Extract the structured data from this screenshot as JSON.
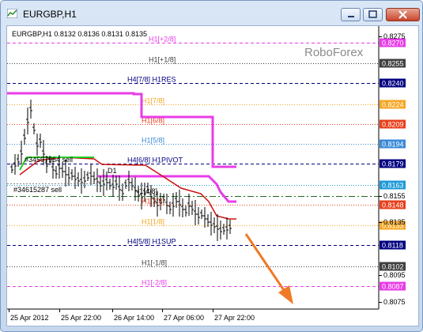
{
  "window": {
    "title": "EURGBP,H1"
  },
  "chart": {
    "symbol_line": "EURGBP,H1  0.8132 0.8136 0.8131 0.8135",
    "brand": "RoboForex",
    "annotations": [
      "#34597964 sell",
      "#34615287 sell",
      "D1",
      "H1[4/8]"
    ]
  },
  "price_axis": {
    "labels": [
      "0.8275",
      "0.8270",
      "0.8255",
      "0.8240",
      "0.8224",
      "0.8209",
      "0.8194",
      "0.8179",
      "0.8163",
      "0.8155",
      "0.8148",
      "0.8135",
      "0.8133",
      "0.8118",
      "0.8102",
      "0.8095",
      "0.8087",
      "0.8075"
    ]
  },
  "time_axis": {
    "labels": [
      "25 Apr 2012",
      "25 Apr 22:00",
      "26 Apr 14:00",
      "27 Apr 06:00",
      "27 Apr 22:00"
    ]
  },
  "levels": [
    {
      "label": "H1[+2/8]",
      "price": 0.827,
      "color": "#e83ce8",
      "style": "dash",
      "badge": true
    },
    {
      "label": "H1[+1/8]",
      "price": 0.8255,
      "color": "#404040",
      "style": "dot",
      "badge": true
    },
    {
      "label": "H4[7/8] H1RES",
      "price": 0.824,
      "color": "#000080",
      "style": "dash",
      "badge": true
    },
    {
      "label": "H1[7/8]",
      "price": 0.8224,
      "color": "#f5a623",
      "style": "dot",
      "badge": true
    },
    {
      "label": "H1[6/8]",
      "price": 0.8209,
      "color": "#e8401c",
      "style": "dot",
      "badge": true
    },
    {
      "label": "H1[5/8]",
      "price": 0.8194,
      "color": "#3a8ad8",
      "style": "dot",
      "badge": true
    },
    {
      "label": "H4[6/8] H1PIVOT",
      "price": 0.8179,
      "color": "#000080",
      "style": "dash",
      "badge": true
    },
    {
      "label": "",
      "price": 0.8163,
      "color": "#1c9ad8",
      "style": "dot",
      "badge": true
    },
    {
      "label": "",
      "price": 0.8155,
      "color": "#1e6b1e",
      "style": "dashdot",
      "badge": false
    },
    {
      "label": "H1[2/8]",
      "price": 0.8148,
      "color": "#e8401c",
      "style": "dot",
      "badge": true
    },
    {
      "label": "H1[1/8]",
      "price": 0.8133,
      "color": "#f5a623",
      "style": "dot",
      "badge": true
    },
    {
      "label": "H4[5/8] H1SUP",
      "price": 0.8118,
      "color": "#000080",
      "style": "dash",
      "badge": true
    },
    {
      "label": "H1[-1/8]",
      "price": 0.8102,
      "color": "#404040",
      "style": "dot",
      "badge": true
    },
    {
      "label": "H1[-2/8]",
      "price": 0.8087,
      "color": "#e83ce8",
      "style": "dash",
      "badge": true
    }
  ],
  "colors": {
    "magenta_line": "#e83ce8",
    "red_line": "#cc1010",
    "green_line": "#22cc22",
    "arrow": "#f07a28",
    "brand": "#8a8a8a"
  }
}
